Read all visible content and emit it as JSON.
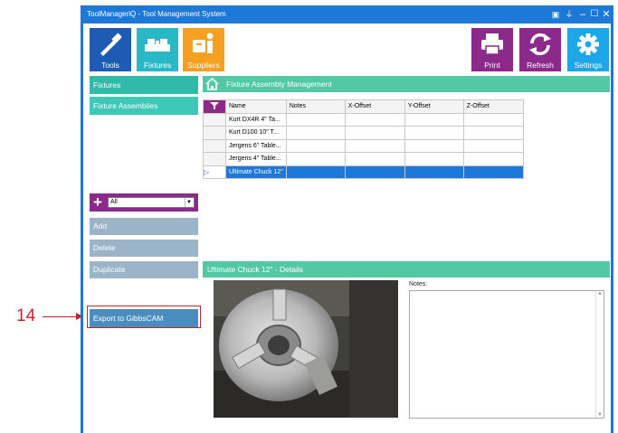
{
  "window": {
    "title": "ToolManageriQ - Tool Management System",
    "controls": {
      "minimize": "–",
      "maximize": "☐",
      "close": "✕"
    }
  },
  "toolbar": {
    "tools": {
      "label": "Tools",
      "icon": "tool-icon",
      "color": "#1e5bb5"
    },
    "fixtures": {
      "label": "Fixtures",
      "icon": "fixture-icon",
      "color": "#2bb8c6"
    },
    "suppliers": {
      "label": "Suppliers",
      "icon": "supplier-icon",
      "color": "#f5a020"
    },
    "print": {
      "label": "Print",
      "icon": "printer-icon",
      "color": "#8c2a8c"
    },
    "refresh": {
      "label": "Refresh",
      "icon": "refresh-icon",
      "color": "#8c2a8c"
    },
    "settings": {
      "label": "Settings",
      "icon": "gear-icon",
      "color": "#1ea7e8"
    }
  },
  "sidebar": {
    "items": [
      {
        "label": "Fixtures"
      },
      {
        "label": "Fixture Assemblies"
      }
    ],
    "filter": {
      "value": "All"
    },
    "actions": {
      "add": "Add",
      "delete": "Delete",
      "duplicate": "Duplicate"
    },
    "export_label": "Export to GibbsCAM"
  },
  "main": {
    "header_title": "Fixture Assembly Management",
    "columns": [
      "Name",
      "Notes",
      "X-Offset",
      "Y-Offset",
      "Z-Offset"
    ],
    "rows": [
      {
        "name": "Kurt DX4R 4\" Ta..."
      },
      {
        "name": "Kurt D100 10\" T..."
      },
      {
        "name": "Jergens 6\" Table..."
      },
      {
        "name": "Jergens 4\" Table..."
      },
      {
        "name": "Ultimate Chuck 12\"",
        "selected": true
      }
    ],
    "details_title": "Ultimate Chuck 12\" - Details",
    "notes_label": "Notes:"
  },
  "annotation": {
    "number": "14"
  }
}
